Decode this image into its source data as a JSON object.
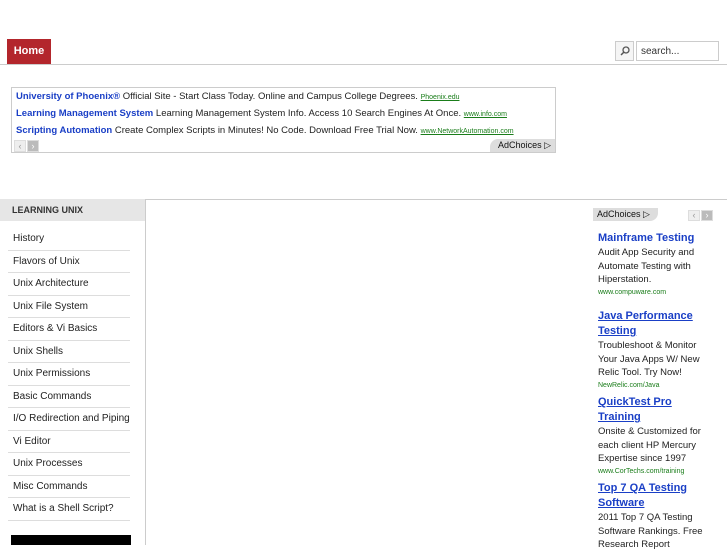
{
  "nav": {
    "home": "Home"
  },
  "search": {
    "placeholder": "search..."
  },
  "top_ads": [
    {
      "title": "University of Phoenix®",
      "text": "Official Site - Start Class Today. Online and Campus College Degrees.",
      "url": "Phoenix.edu"
    },
    {
      "title": "Learning Management System",
      "text": "Learning Management System Info. Access 10 Search Engines At Once.",
      "url": "www.info.com"
    },
    {
      "title": "Scripting Automation",
      "text": "Create Complex Scripts in Minutes! No Code. Download Free Trial Now.",
      "url": "www.NetworkAutomation.com"
    }
  ],
  "adchoices": "AdChoices ▷",
  "sidebar": {
    "heading": "LEARNING UNIX",
    "items": [
      "History",
      "Flavors of Unix",
      "Unix Architecture",
      "Unix File System",
      "Editors & Vi Basics",
      "Unix Shells",
      "Unix Permissions",
      "Basic Commands",
      "I/O Redirection and Piping",
      "Vi Editor",
      "Unix Processes",
      "Misc Commands",
      "What is a Shell Script?"
    ]
  },
  "right_ads": [
    {
      "title": "Mainframe Testing",
      "text": "Audit App Security and Automate Testing with Hiperstation.",
      "url": "www.compuware.com"
    },
    {
      "title": "Java Performance Testing",
      "text": "Troubleshoot & Monitor Your Java Apps W/ New Relic Tool. Try Now!",
      "url": "NewRelic.com/Java"
    },
    {
      "title": "QuickTest Pro Training",
      "text": "Onsite & Customized for each client HP Mercury Expertise since 1997",
      "url": "www.CorTechs.com/training"
    },
    {
      "title": "Top 7 QA Testing Software",
      "text": "2011 Top 7 QA Testing Software Rankings. Free Research Report",
      "url": ""
    }
  ]
}
